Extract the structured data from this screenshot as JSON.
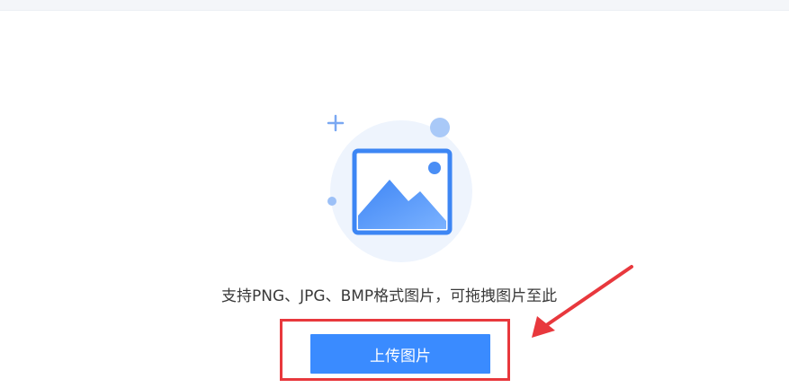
{
  "upload": {
    "hint": "支持PNG、JPG、BMP格式图片，可拖拽图片至此",
    "button_label": "上传图片"
  },
  "icons": {
    "illustration": "image-placeholder-icon",
    "plus": "plus-icon"
  },
  "colors": {
    "accent": "#3a8bff",
    "annotation": "#e8383d",
    "illustration_bg": "#eef4fd"
  }
}
